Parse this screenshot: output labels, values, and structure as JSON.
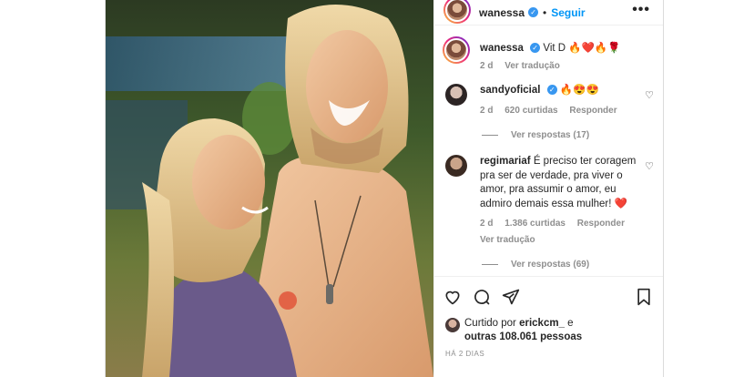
{
  "post": {
    "username": "wanessa",
    "verified_glyph": "✓",
    "separator": "•",
    "follow_label": "Seguir",
    "more_label": "•••",
    "caption": {
      "username": "wanessa",
      "text": "Vit D 🔥❤️🔥🌹",
      "age": "2 d",
      "translation": "Ver tradução"
    }
  },
  "comments": [
    {
      "username": "sandyoficial",
      "verified": true,
      "text": "🔥😍😍",
      "age": "2 d",
      "likes": "620 curtidas",
      "reply": "Responder",
      "view_replies": "Ver respostas (17)"
    },
    {
      "username": "regimariaf",
      "verified": false,
      "text": "É preciso ter coragem pra ser de verdade, pra viver o amor, pra assumir o amor, eu admiro demais essa mulher! ❤️",
      "age": "2 d",
      "likes": "1.386 curtidas",
      "reply": "Responder",
      "translation": "Ver tradução",
      "view_replies": "Ver respostas (69)"
    }
  ],
  "footer": {
    "liked_prefix": "Curtido por",
    "liked_user": "erickcm_",
    "liked_joiner": "e",
    "liked_others": "outras 108.061 pessoas",
    "time_ago": "HÁ 2 DIAS"
  },
  "icons": [
    "heart-icon",
    "comment-icon",
    "share-icon",
    "bookmark-icon",
    "more-icon",
    "verified-icon"
  ],
  "colors": {
    "accent": "#0095f6",
    "verified": "#3897f0",
    "text": "#262626",
    "muted": "#8e8e8e"
  }
}
